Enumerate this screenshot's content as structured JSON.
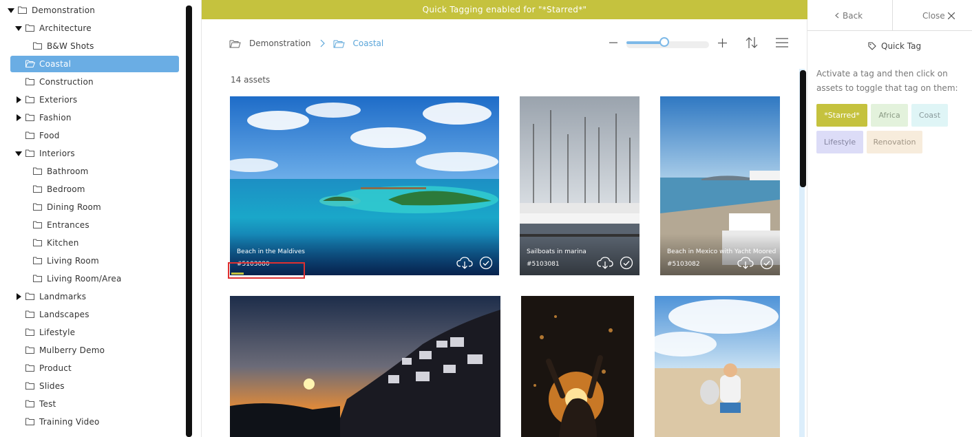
{
  "sidebar": {
    "tree": [
      {
        "label": "Demonstration",
        "caret": "down"
      },
      {
        "label": "Architecture",
        "caret": "down"
      },
      {
        "label": "B&W Shots",
        "caret": "none"
      },
      {
        "label": "Coastal",
        "caret": "none",
        "selected": true
      },
      {
        "label": "Construction",
        "caret": "none"
      },
      {
        "label": "Exteriors",
        "caret": "right"
      },
      {
        "label": "Fashion",
        "caret": "right"
      },
      {
        "label": "Food",
        "caret": "none"
      },
      {
        "label": "Interiors",
        "caret": "down"
      },
      {
        "label": "Bathroom",
        "caret": "none"
      },
      {
        "label": "Bedroom",
        "caret": "none"
      },
      {
        "label": "Dining Room",
        "caret": "none"
      },
      {
        "label": "Entrances",
        "caret": "none"
      },
      {
        "label": "Kitchen",
        "caret": "none"
      },
      {
        "label": "Living Room",
        "caret": "none"
      },
      {
        "label": "Living Room/Area",
        "caret": "none"
      },
      {
        "label": "Landmarks",
        "caret": "right"
      },
      {
        "label": "Landscapes",
        "caret": "none"
      },
      {
        "label": "Lifestyle",
        "caret": "none"
      },
      {
        "label": "Mulberry Demo",
        "caret": "none"
      },
      {
        "label": "Product",
        "caret": "none"
      },
      {
        "label": "Slides",
        "caret": "none"
      },
      {
        "label": "Test",
        "caret": "none"
      },
      {
        "label": "Training Video",
        "caret": "none"
      }
    ]
  },
  "banner": {
    "text": "Quick Tagging enabled for \"*Starred*\""
  },
  "breadcrumb": {
    "root": "Demonstration",
    "current": "Coastal"
  },
  "zoom": {
    "level": 0.46
  },
  "asset_count": "14 assets",
  "assets": [
    {
      "title": "Beach in the Maldives",
      "id": "#5103080",
      "scene": "maldives",
      "tagged": true
    },
    {
      "title": "Sailboats in marina",
      "id": "#5103081",
      "scene": "marina",
      "tagged": false
    },
    {
      "title": "Beach in Mexico with Yacht Moored",
      "id": "#5103082",
      "scene": "mexico",
      "tagged": false
    },
    {
      "title": "",
      "id": "",
      "scene": "sunset",
      "tagged": false
    },
    {
      "title": "",
      "id": "",
      "scene": "splash",
      "tagged": false
    },
    {
      "title": "",
      "id": "",
      "scene": "boydog",
      "tagged": false
    }
  ],
  "right_panel": {
    "back_label": "Back",
    "close_label": "Close",
    "title": "Quick Tag",
    "description": "Activate a tag and then click on assets to toggle that tag on them:",
    "tags": [
      {
        "label": "*Starred*",
        "bg": "#c5c23e",
        "fg": "#ffffff",
        "active": true
      },
      {
        "label": "Africa",
        "bg": "#e3f2dc",
        "fg": "#8a9a84",
        "active": false
      },
      {
        "label": "Coast",
        "bg": "#dff5f6",
        "fg": "#8a9a9c",
        "active": false
      },
      {
        "label": "Lifestyle",
        "bg": "#dcdcf7",
        "fg": "#8585a0",
        "active": false
      },
      {
        "label": "Renovation",
        "bg": "#f7ecdc",
        "fg": "#a09585",
        "active": false
      }
    ]
  },
  "colors": {
    "accent": "#c5c23e",
    "selected": "#6aade4",
    "link": "#5aa5d9"
  }
}
